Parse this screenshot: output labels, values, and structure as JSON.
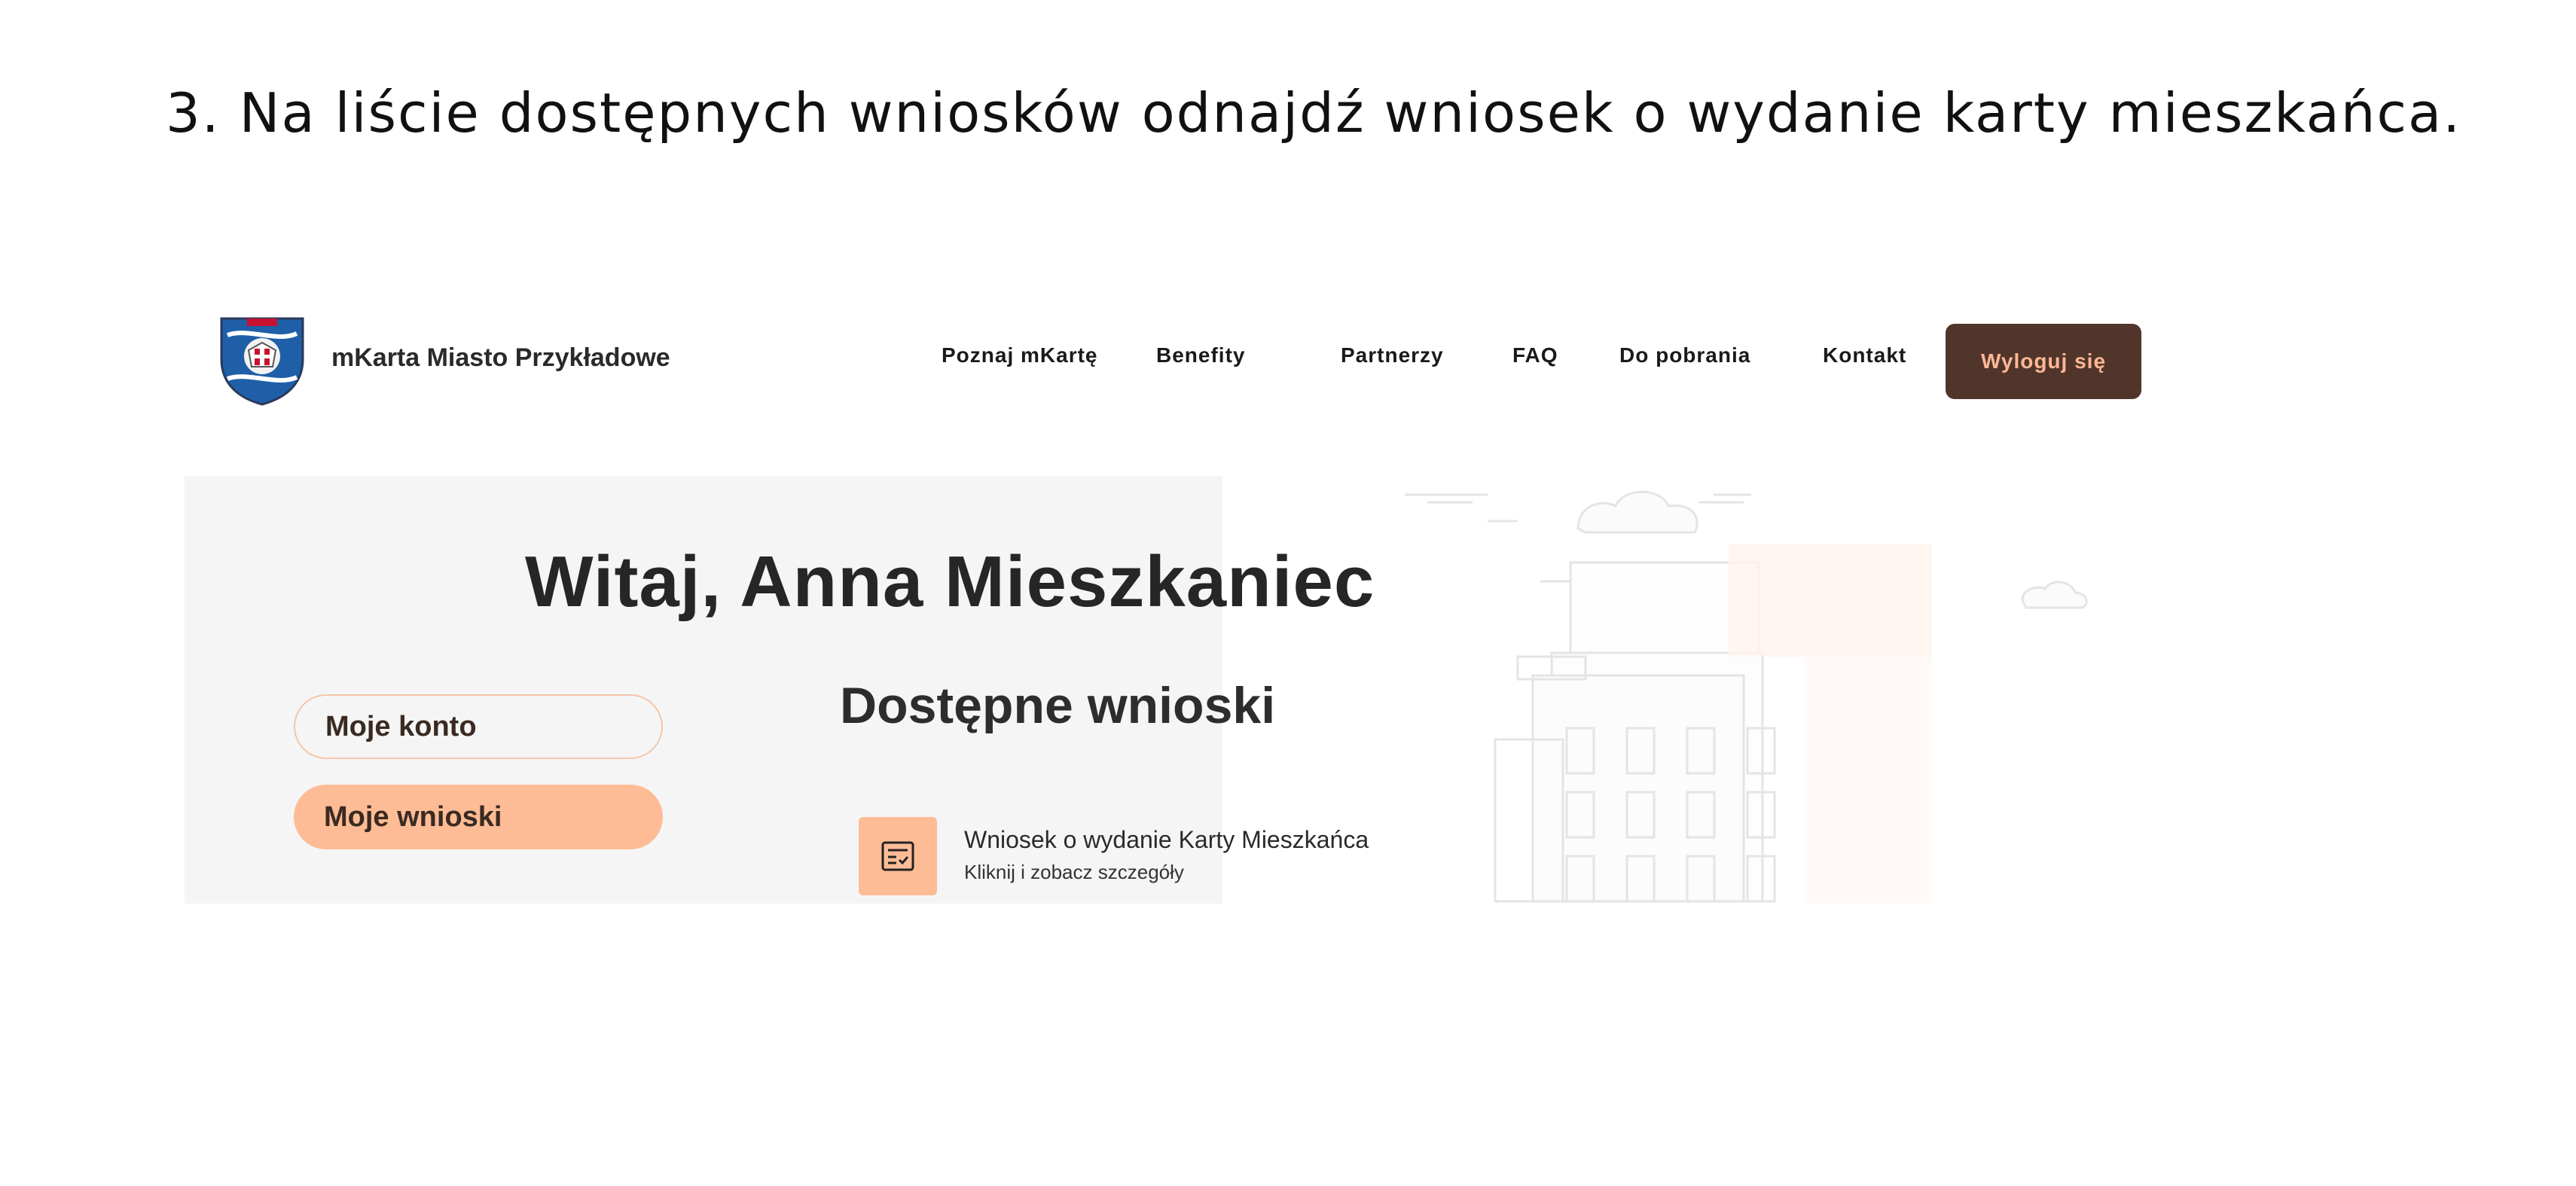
{
  "instruction": "3. Na liście dostępnych wniosków odnajdź wniosek o wydanie karty mieszkańca.",
  "header": {
    "brand": "mKarta Miasto Przykładowe",
    "nav": [
      "Poznaj mKartę",
      "Benefity",
      "Partnerzy",
      "FAQ",
      "Do pobrania",
      "Kontakt"
    ],
    "logout_label": "Wyloguj się"
  },
  "main": {
    "greeting": "Witaj, Anna Mieszkaniec",
    "section_title": "Dostępne wnioski",
    "sidebar": {
      "account_label": "Moje konto",
      "applications_label": "Moje wnioski"
    },
    "applications": [
      {
        "title": "Wniosek o wydanie Karty Mieszkańca",
        "subtitle": "Kliknij i zobacz szczegóły",
        "icon": "form-checklist-icon"
      }
    ]
  },
  "colors": {
    "accent": "#fdbc95",
    "logout_bg": "#51352a",
    "logout_text": "#ffb796",
    "panel_bg": "#f5f5f5"
  }
}
